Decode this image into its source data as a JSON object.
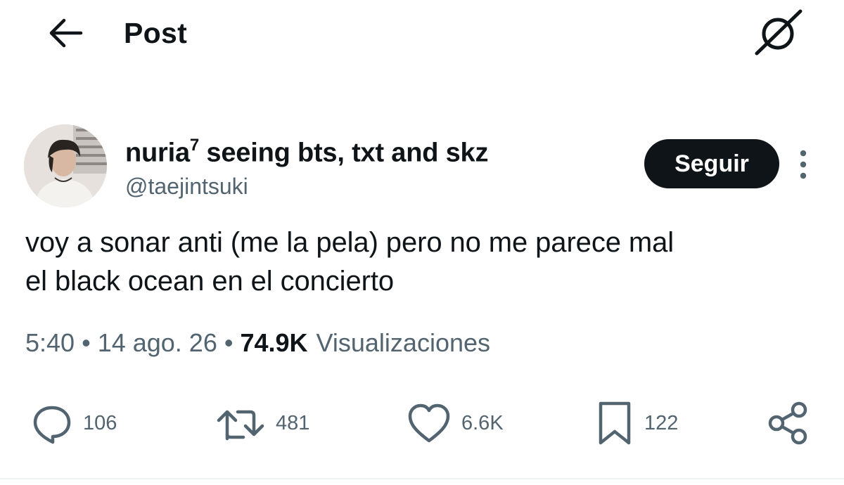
{
  "header": {
    "title": "Post",
    "back_icon": "arrow-left-icon",
    "grok_icon": "grok-icon"
  },
  "author": {
    "display_name": "nuria",
    "display_name_sup": "7",
    "display_name_rest": " seeing bts, txt and skz",
    "handle": "@taejintsuki",
    "follow_label": "Seguir"
  },
  "tweet": {
    "line1": "voy a sonar anti (me la pela) pero no me parece mal",
    "line2": "el black ocean en el concierto"
  },
  "meta": {
    "time": "5:40",
    "separator": "•",
    "date": "14 ago. 26",
    "views_count": "74.9K",
    "views_label": "Visualizaciones"
  },
  "actions": {
    "replies": "106",
    "retweets": "481",
    "likes": "6.6K",
    "bookmarks": "122"
  },
  "colors": {
    "text_primary": "#0f1419",
    "text_secondary": "#536471",
    "button_bg": "#0f1419"
  }
}
